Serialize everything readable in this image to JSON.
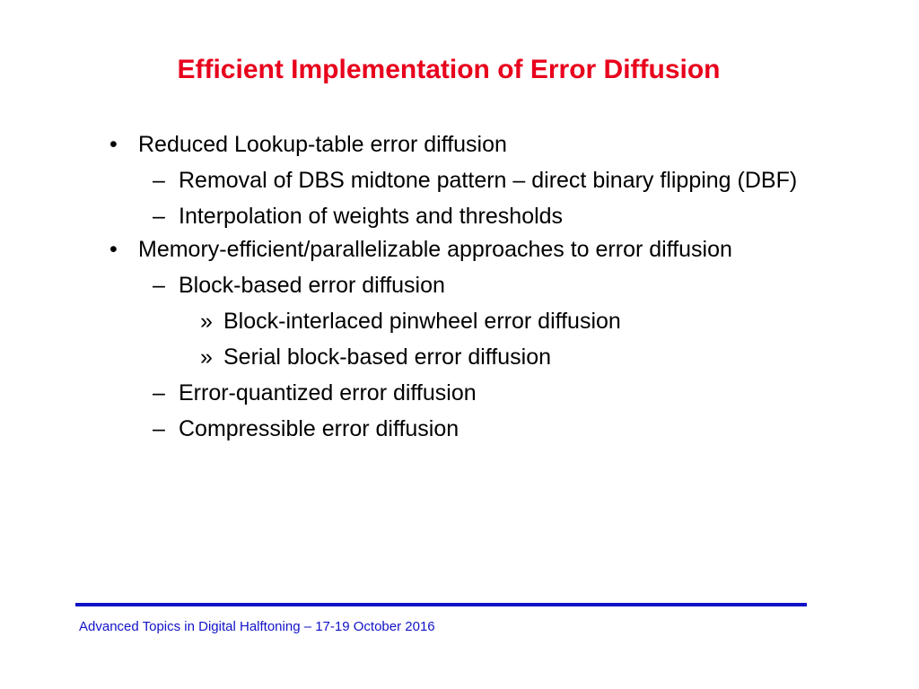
{
  "slide": {
    "title": "Efficient Implementation of Error Diffusion",
    "bullets": [
      {
        "marker": "•",
        "level": 1,
        "text": "Reduced Lookup-table error diffusion"
      },
      {
        "marker": "–",
        "level": 2,
        "text": "Removal of DBS midtone pattern – direct binary flipping (DBF)"
      },
      {
        "marker": "–",
        "level": 2,
        "text": "Interpolation of weights and thresholds"
      },
      {
        "marker": "•",
        "level": 1,
        "text": "Memory-efficient/parallelizable approaches to error diffusion"
      },
      {
        "marker": "–",
        "level": 2,
        "text": "Block-based error diffusion"
      },
      {
        "marker": "»",
        "level": 3,
        "text": "Block-interlaced pinwheel error diffusion"
      },
      {
        "marker": "»",
        "level": 3,
        "text": "Serial block-based error diffusion"
      },
      {
        "marker": "–",
        "level": 2,
        "text": "Error-quantized error diffusion"
      },
      {
        "marker": "–",
        "level": 2,
        "text": "Compressible error diffusion"
      }
    ],
    "footer": "Advanced Topics in Digital Halftoning – 17-19 October 2016"
  },
  "colors": {
    "title": "#e8001c",
    "footer": "#1212c8",
    "body_text": "#000000",
    "background": "#ffffff"
  }
}
